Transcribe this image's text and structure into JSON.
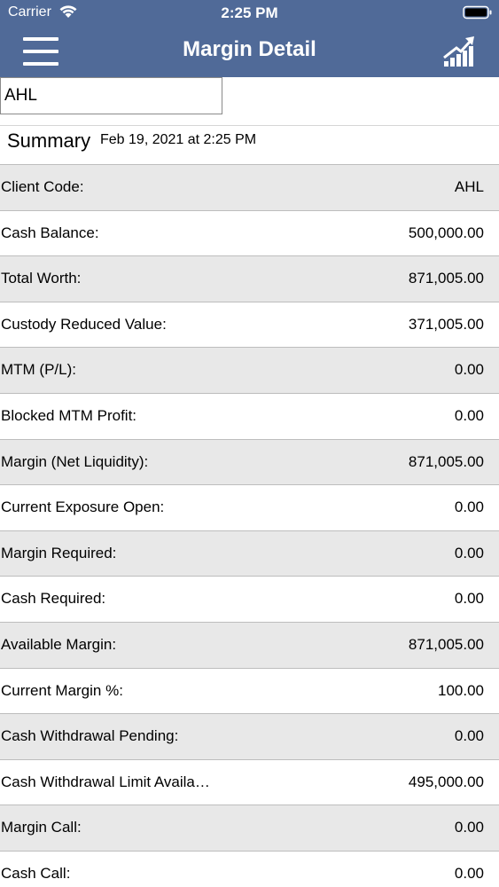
{
  "status_bar": {
    "carrier": "Carrier",
    "time": "2:25 PM"
  },
  "nav": {
    "title": "Margin Detail",
    "menu_icon": "hamburger-menu-icon",
    "chart_icon": "growth-chart-icon"
  },
  "search": {
    "value": "AHL"
  },
  "summary": {
    "title": "Summary",
    "date": "Feb 19, 2021 at 2:25 PM"
  },
  "rows": [
    {
      "label": "Client Code:",
      "value": "AHL"
    },
    {
      "label": "Cash Balance:",
      "value": "500,000.00"
    },
    {
      "label": "Total Worth:",
      "value": "871,005.00"
    },
    {
      "label": "Custody Reduced Value:",
      "value": "371,005.00"
    },
    {
      "label": "MTM (P/L):",
      "value": "0.00"
    },
    {
      "label": "Blocked MTM Profit:",
      "value": "0.00"
    },
    {
      "label": "Margin (Net Liquidity):",
      "value": "871,005.00"
    },
    {
      "label": "Current Exposure Open:",
      "value": "0.00"
    },
    {
      "label": "Margin Required:",
      "value": "0.00"
    },
    {
      "label": "Cash Required:",
      "value": "0.00"
    },
    {
      "label": "Available Margin:",
      "value": "871,005.00"
    },
    {
      "label": "Current Margin %:",
      "value": "100.00"
    },
    {
      "label": "Cash Withdrawal Pending:",
      "value": "0.00"
    },
    {
      "label": "Cash Withdrawal Limit Availa…",
      "value": "495,000.00"
    },
    {
      "label": "Margin Call:",
      "value": "0.00"
    },
    {
      "label": "Cash Call:",
      "value": "0.00"
    }
  ],
  "colors": {
    "header_bg": "#506a98",
    "row_shaded": "#e8e8e8",
    "row_plain": "#ffffff"
  }
}
